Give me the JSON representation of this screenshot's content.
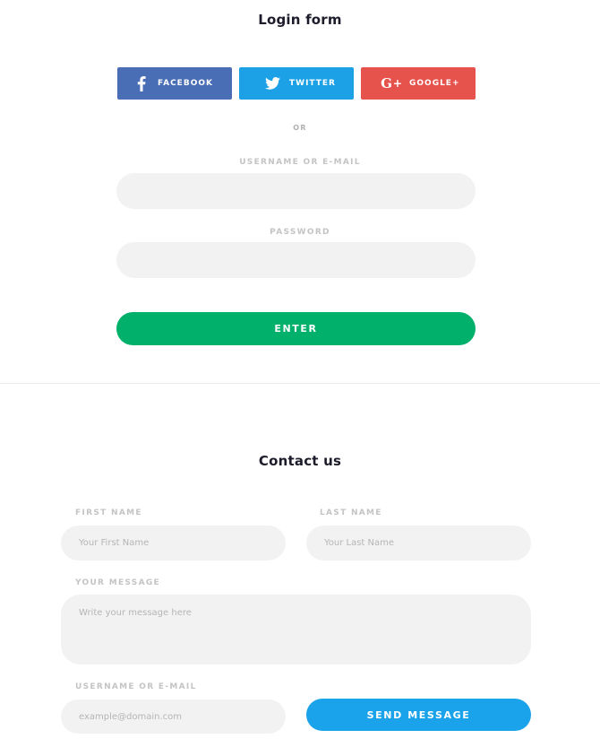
{
  "login": {
    "title": "Login form",
    "social": {
      "facebook": "FACEBOOK",
      "twitter": "TWITTER",
      "google": "GOOGLE+"
    },
    "or_text": "OR",
    "username_label": "USERNAME OR E-MAIL",
    "password_label": "PASSWORD",
    "enter_label": "ENTER"
  },
  "contact": {
    "title": "Contact us",
    "first_name_label": "FIRST NAME",
    "first_name_placeholder": "Your First Name",
    "last_name_label": "LAST NAME",
    "last_name_placeholder": "Your Last Name",
    "message_label": "YOUR MESSAGE",
    "message_placeholder": "Write your message here",
    "email_label": "USERNAME OR E-MAIL",
    "email_placeholder": "example@domain.com",
    "send_label": "SEND MESSAGE"
  },
  "colors": {
    "facebook": "#4a6eb5",
    "twitter": "#1da1e6",
    "google": "#e6524c",
    "enter": "#00b06b",
    "send": "#1aa3ea"
  },
  "icons": {
    "facebook": "facebook-f-icon",
    "twitter": "twitter-bird-icon",
    "google": "google-plus-icon"
  }
}
